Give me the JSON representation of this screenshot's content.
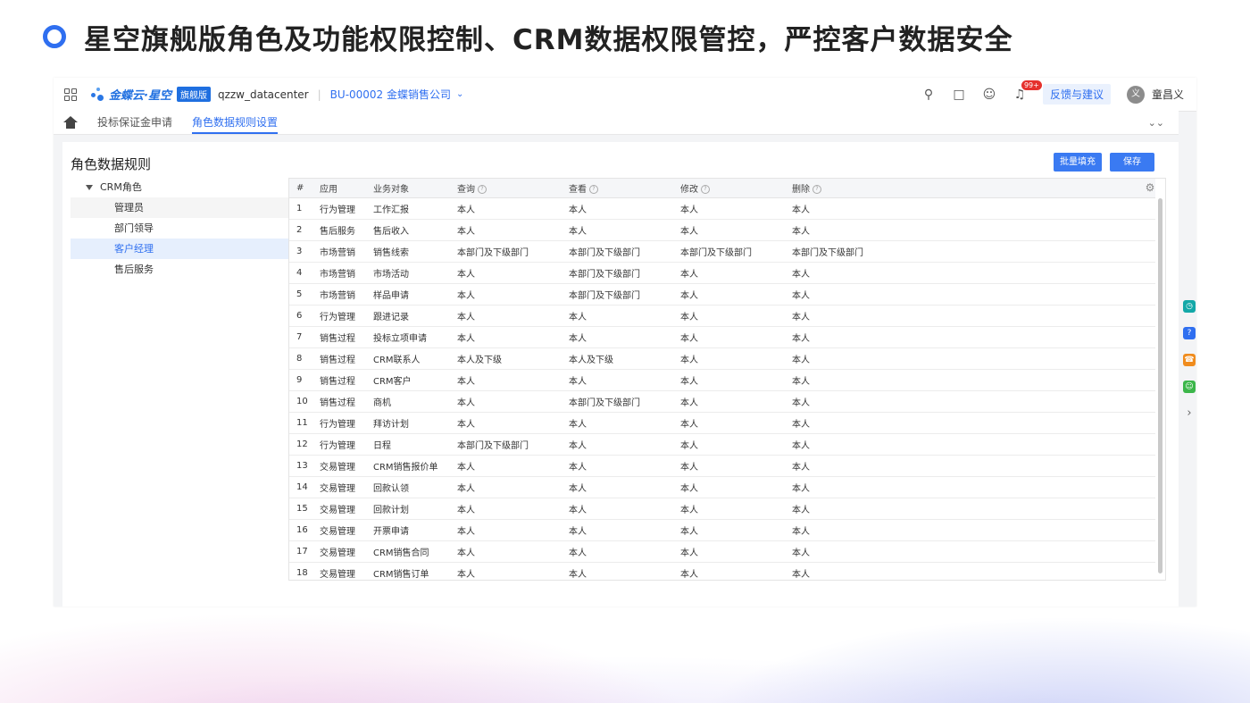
{
  "slide_title": "星空旗舰版角色及功能权限控制、CRM数据权限管控，严控客户数据安全",
  "topbar": {
    "logo_text": "金蝶云·星空",
    "logo_badge": "旗舰版",
    "tenant": "qzzw_datacenter",
    "separator": "|",
    "org": "BU-00002 金蝶销售公司",
    "notification_badge": "99+",
    "feedback_label": "反馈与建议",
    "avatar_text": "义",
    "username": "童昌义"
  },
  "tabs": [
    {
      "label": "投标保证金申请",
      "active": false
    },
    {
      "label": "角色数据规则设置",
      "active": true
    }
  ],
  "page": {
    "heading": "角色数据规则",
    "batch_fill_label": "批量填充",
    "save_label": "保存"
  },
  "tree": {
    "root": "CRM角色",
    "items": [
      {
        "label": "管理员",
        "state": "shaded"
      },
      {
        "label": "部门领导",
        "state": ""
      },
      {
        "label": "客户经理",
        "state": "selected"
      },
      {
        "label": "售后服务",
        "state": ""
      }
    ]
  },
  "table": {
    "headers": {
      "num": "#",
      "app": "应用",
      "object": "业务对象",
      "query": "查询",
      "view": "查看",
      "modify": "修改",
      "delete": "删除"
    },
    "rows": [
      [
        "1",
        "行为管理",
        "工作汇报",
        "本人",
        "本人",
        "本人",
        "本人"
      ],
      [
        "2",
        "售后服务",
        "售后收入",
        "本人",
        "本人",
        "本人",
        "本人"
      ],
      [
        "3",
        "市场营销",
        "销售线索",
        "本部门及下级部门",
        "本部门及下级部门",
        "本部门及下级部门",
        "本部门及下级部门"
      ],
      [
        "4",
        "市场营销",
        "市场活动",
        "本人",
        "本部门及下级部门",
        "本人",
        "本人"
      ],
      [
        "5",
        "市场营销",
        "样品申请",
        "本人",
        "本部门及下级部门",
        "本人",
        "本人"
      ],
      [
        "6",
        "行为管理",
        "跟进记录",
        "本人",
        "本人",
        "本人",
        "本人"
      ],
      [
        "7",
        "销售过程",
        "投标立项申请",
        "本人",
        "本人",
        "本人",
        "本人"
      ],
      [
        "8",
        "销售过程",
        "CRM联系人",
        "本人及下级",
        "本人及下级",
        "本人",
        "本人"
      ],
      [
        "9",
        "销售过程",
        "CRM客户",
        "本人",
        "本人",
        "本人",
        "本人"
      ],
      [
        "10",
        "销售过程",
        "商机",
        "本人",
        "本部门及下级部门",
        "本人",
        "本人"
      ],
      [
        "11",
        "行为管理",
        "拜访计划",
        "本人",
        "本人",
        "本人",
        "本人"
      ],
      [
        "12",
        "行为管理",
        "日程",
        "本部门及下级部门",
        "本人",
        "本人",
        "本人"
      ],
      [
        "13",
        "交易管理",
        "CRM销售报价单",
        "本人",
        "本人",
        "本人",
        "本人"
      ],
      [
        "14",
        "交易管理",
        "回款认领",
        "本人",
        "本人",
        "本人",
        "本人"
      ],
      [
        "15",
        "交易管理",
        "回款计划",
        "本人",
        "本人",
        "本人",
        "本人"
      ],
      [
        "16",
        "交易管理",
        "开票申请",
        "本人",
        "本人",
        "本人",
        "本人"
      ],
      [
        "17",
        "交易管理",
        "CRM销售合同",
        "本人",
        "本人",
        "本人",
        "本人"
      ],
      [
        "18",
        "交易管理",
        "CRM销售订单",
        "本人",
        "本人",
        "本人",
        "本人"
      ]
    ]
  },
  "icons": {
    "search": "search-icon",
    "chat": "chat-icon",
    "robot": "robot-icon",
    "bell": "bell-icon",
    "settings": "gear-icon",
    "home": "home-icon"
  },
  "colors": {
    "accent": "#2f6ff0",
    "badge": "#e5312d"
  }
}
